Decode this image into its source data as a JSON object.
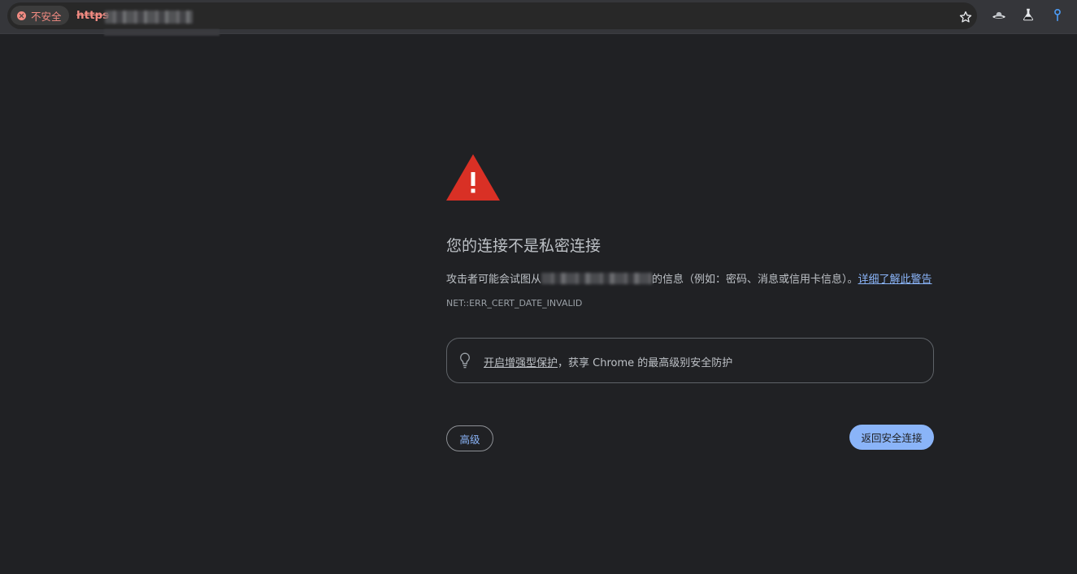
{
  "toolbar": {
    "security_chip_label": "不安全",
    "url_scheme": "https",
    "star_icon": "bookmark-star-icon",
    "extensions": [
      "hat-extension-icon",
      "flask-extension-icon",
      "pin-extension-icon"
    ]
  },
  "interstitial": {
    "title": "您的连接不是私密连接",
    "desc_prefix": "攻击者可能会试图从",
    "desc_suffix": "的信息（例如：密码、消息或信用卡信息）。",
    "learn_more": "详细了解此警告",
    "error_code": "NET::ERR_CERT_DATE_INVALID",
    "promo_link": "开启增强型保护",
    "promo_rest": "，获享 Chrome 的最高级别安全防护",
    "advanced_label": "高级",
    "back_label": "返回安全连接"
  },
  "colors": {
    "background": "#202124",
    "danger": "#d93025",
    "link": "#8ab4f8",
    "text": "#bdc1c6",
    "insecure": "#f28b82"
  }
}
